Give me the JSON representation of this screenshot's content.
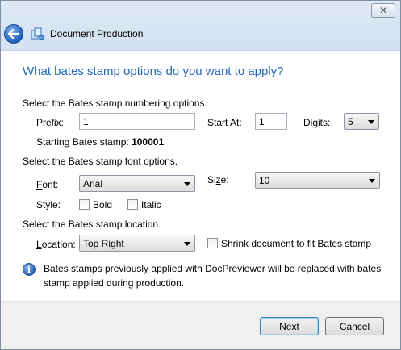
{
  "window": {
    "title": "Document Production",
    "close_glyph": "✕",
    "back_icon": "back-arrow-icon",
    "app_icon": "document-production-icon"
  },
  "page": {
    "heading": "What bates stamp options do you want to apply?"
  },
  "numbering": {
    "section_label": "Select the Bates stamp numbering options.",
    "prefix_access": "P",
    "prefix_rest": "refix:",
    "prefix_value": "1",
    "start_access": "S",
    "start_rest": "tart At:",
    "start_value": "1",
    "digits_access": "D",
    "digits_rest": "igits:",
    "digits_value": "5",
    "starting_label": "Starting Bates stamp:",
    "starting_value": "100001"
  },
  "font_options": {
    "section_label": "Select the Bates stamp font options.",
    "font_access": "F",
    "font_rest": "ont:",
    "font_value": "Arial",
    "size_pre": "Si",
    "size_access": "z",
    "size_rest": "e:",
    "size_value": "10",
    "style_label": "Style:",
    "bold_label": "Bold",
    "bold_checked": false,
    "italic_label": "Italic",
    "italic_checked": false
  },
  "location": {
    "section_label": "Select the Bates stamp location.",
    "location_access": "L",
    "location_rest": "ocation:",
    "location_value": "Top Right",
    "shrink_label": "Shrink document to fit Bates stamp",
    "shrink_checked": false
  },
  "info": {
    "line1": "Bates stamps previously applied with DocPreviewer will be replaced with bates",
    "line2": "stamp applied during production."
  },
  "footer": {
    "next_access": "N",
    "next_rest": "ext",
    "cancel_pre": "",
    "cancel_access": "C",
    "cancel_rest": "ancel"
  }
}
